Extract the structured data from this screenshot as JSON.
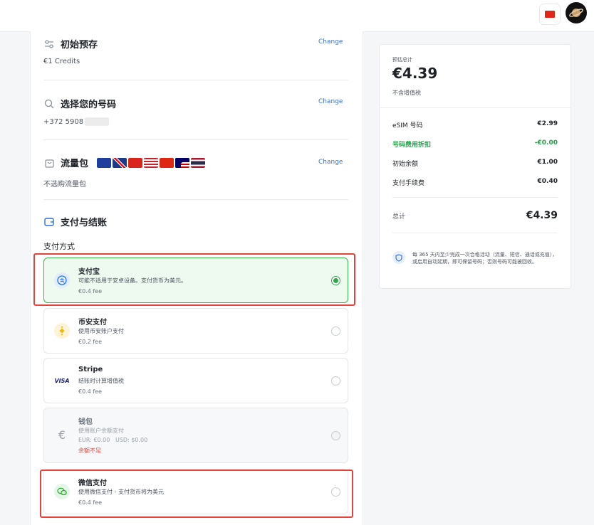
{
  "header": {
    "language_flag": "china-flag",
    "avatar_icon": "planet-avatar"
  },
  "initial_deposit": {
    "title": "初始预存",
    "value": "€1 Credits",
    "change": "Change"
  },
  "number": {
    "title": "选择您的号码",
    "value": "+372 5908",
    "change": "Change"
  },
  "data_pack": {
    "title": "流量包",
    "value": "不选购流量包",
    "change": "Change",
    "flags": [
      "eu-flag",
      "uk-flag",
      "swiss-flag",
      "us-flag",
      "china-flag",
      "malaysia-flag",
      "thailand-flag"
    ]
  },
  "payment": {
    "title": "支付与结账",
    "method_label": "支付方式",
    "methods": [
      {
        "name": "支付宝",
        "desc": "可能不适用于安卓设备。支付货币为美元。",
        "fee": "€0.4 fee",
        "selected": true
      },
      {
        "name": "币安支付",
        "desc": "使用币安账户支付",
        "fee": "€0.2 fee",
        "selected": false
      },
      {
        "name": "Stripe",
        "desc": "结账时计算增值税",
        "fee": "€0.4 fee",
        "selected": false,
        "logo": "VISA"
      },
      {
        "name": "钱包",
        "desc": "使用账户余额支付",
        "balance": "EUR: €0.00   USD: $0.00",
        "warning": "余额不足",
        "selected": false
      },
      {
        "name": "微信支付",
        "desc": "使用微信支付 - 支付货币将为美元",
        "fee": "€0.4 fee",
        "selected": false
      }
    ]
  },
  "summary": {
    "estimate_label": "预估总计",
    "estimate_total": "€4.39",
    "tax_note": "不含增值税",
    "rows": [
      {
        "label": "eSIM 号码",
        "value": "€2.99"
      },
      {
        "label": "号码费用折扣",
        "value": "-€0.00"
      },
      {
        "label": "初始余额",
        "value": "€1.00"
      },
      {
        "label": "支付手续费",
        "value": "€0.40"
      }
    ],
    "total_label": "总计",
    "total_value": "€4.39",
    "notice": "每 365 天内至少完成一次合格活动（流量、短信、通话或充值），或启用自动延期，即可保留号码；否则号码可能被回收。"
  },
  "colors": {
    "accent_green": "#22a34a",
    "link_blue": "#3b6fd6",
    "highlight_red": "#e2433b"
  }
}
